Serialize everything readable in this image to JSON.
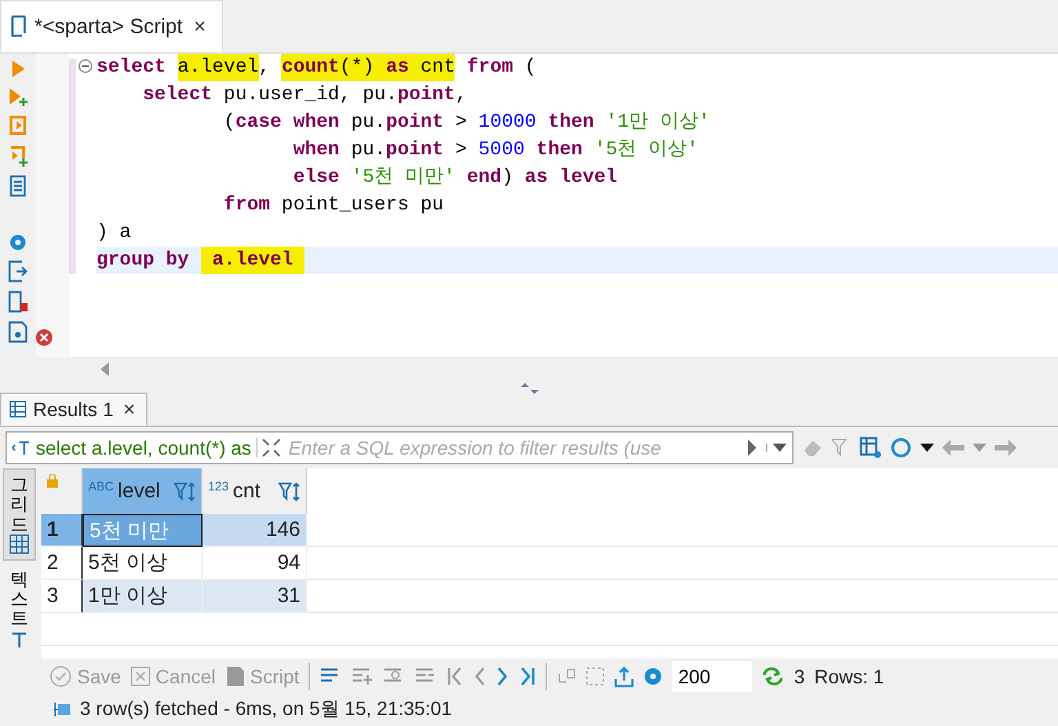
{
  "editor_tab": {
    "title": "*<sparta> Script",
    "selected": true,
    "close": "×"
  },
  "code_lines": [
    {
      "current": false,
      "tokens": [
        {
          "t": "select ",
          "kind": "kw",
          "highlighted": false
        },
        {
          "t": "a.level",
          "kind": "id",
          "highlighted": true
        },
        {
          "t": ", ",
          "kind": "id",
          "highlighted": false
        },
        {
          "t": "count",
          "kind": "kw",
          "highlighted": true
        },
        {
          "t": "(*) ",
          "kind": "id",
          "highlighted": true
        },
        {
          "t": "as",
          "kind": "kw",
          "highlighted": true
        },
        {
          "t": " cnt",
          "kind": "id",
          "highlighted": true
        },
        {
          "t": " from",
          "kind": "kw",
          "highlighted": false
        },
        {
          "t": " (",
          "kind": "id",
          "highlighted": false
        }
      ]
    },
    {
      "current": false,
      "tokens": [
        {
          "t": "    select",
          "kind": "kw",
          "highlighted": false
        },
        {
          "t": " pu.user_id, pu.",
          "kind": "id",
          "highlighted": false
        },
        {
          "t": "point",
          "kind": "kw",
          "highlighted": false
        },
        {
          "t": ",",
          "kind": "id",
          "highlighted": false
        }
      ]
    },
    {
      "current": false,
      "tokens": [
        {
          "t": "           (",
          "kind": "id",
          "highlighted": false
        },
        {
          "t": "case when",
          "kind": "kw",
          "highlighted": false
        },
        {
          "t": " pu.",
          "kind": "id",
          "highlighted": false
        },
        {
          "t": "point",
          "kind": "kw",
          "highlighted": false
        },
        {
          "t": " > ",
          "kind": "id",
          "highlighted": false
        },
        {
          "t": "10000",
          "kind": "num",
          "highlighted": false
        },
        {
          "t": " then ",
          "kind": "kw",
          "highlighted": false
        },
        {
          "t": "'1만 이상'",
          "kind": "str",
          "highlighted": false
        }
      ]
    },
    {
      "current": false,
      "tokens": [
        {
          "t": "                 when",
          "kind": "kw",
          "highlighted": false
        },
        {
          "t": " pu.",
          "kind": "id",
          "highlighted": false
        },
        {
          "t": "point",
          "kind": "kw",
          "highlighted": false
        },
        {
          "t": " > ",
          "kind": "id",
          "highlighted": false
        },
        {
          "t": "5000",
          "kind": "num",
          "highlighted": false
        },
        {
          "t": " then ",
          "kind": "kw",
          "highlighted": false
        },
        {
          "t": "'5천 이상'",
          "kind": "str",
          "highlighted": false
        }
      ]
    },
    {
      "current": false,
      "tokens": [
        {
          "t": "                 else ",
          "kind": "kw",
          "highlighted": false
        },
        {
          "t": "'5천 미만'",
          "kind": "str",
          "highlighted": false
        },
        {
          "t": " end",
          "kind": "kw",
          "highlighted": false
        },
        {
          "t": ") ",
          "kind": "id",
          "highlighted": false
        },
        {
          "t": "as level",
          "kind": "kw",
          "highlighted": false
        }
      ]
    },
    {
      "current": false,
      "tokens": [
        {
          "t": "           from",
          "kind": "kw",
          "highlighted": false
        },
        {
          "t": " point_users pu",
          "kind": "id",
          "highlighted": false
        }
      ]
    },
    {
      "current": false,
      "tokens": [
        {
          "t": ") a",
          "kind": "id",
          "highlighted": false
        }
      ]
    },
    {
      "current": true,
      "tokens": [
        {
          "t": "group by ",
          "kind": "kw",
          "highlighted": false
        },
        {
          "t": " a.level ",
          "kind": "kw",
          "highlighted": true
        }
      ]
    }
  ],
  "results_tab": {
    "title": "Results 1",
    "selected": true,
    "close": "×"
  },
  "filter_bar": {
    "query": "select a.level, count(*) as",
    "placeholder": "Enter a SQL expression to filter results (use"
  },
  "side_tabs": [
    {
      "label": "그리드",
      "selected": true,
      "kind": "grid"
    },
    {
      "label": "텍스트",
      "selected": false,
      "kind": "text"
    }
  ],
  "grid": {
    "columns": [
      {
        "name": "level",
        "type_badge": "ABC",
        "selected": true
      },
      {
        "name": "cnt",
        "type_badge": "123",
        "selected": false
      }
    ],
    "rows": [
      {
        "number": "1",
        "cells": [
          "5천 미만",
          "146"
        ],
        "selected": true
      },
      {
        "number": "2",
        "cells": [
          "5천 이상",
          "94"
        ],
        "selected": false
      },
      {
        "number": "3",
        "cells": [
          "1만 이상",
          "31"
        ],
        "selected": false
      }
    ]
  },
  "bottom_toolbar": {
    "buttons": [
      {
        "label": "Save",
        "disabled": true,
        "kind": "save"
      },
      {
        "label": "Cancel",
        "disabled": true,
        "kind": "cancel"
      },
      {
        "label": "Script",
        "disabled": true,
        "kind": "script"
      }
    ],
    "fetch_size": "200",
    "refresh_count": "3",
    "rows_label": "Rows: 1"
  },
  "status": "3 row(s) fetched - 6ms, on 5월 15, 21:35:01"
}
